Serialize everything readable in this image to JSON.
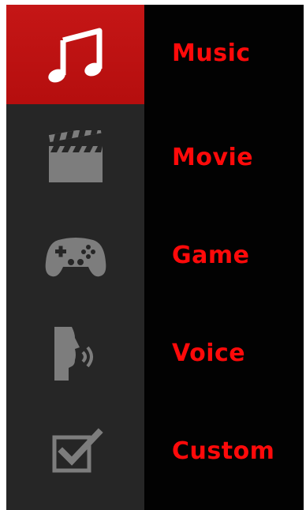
{
  "colors": {
    "background": "#020202",
    "sidebar": "#262626",
    "active": "#c51616",
    "label": "#ff0a0a",
    "icon_inactive": "#7d7d7d",
    "icon_active": "#ffffff"
  },
  "modes": [
    {
      "label": "Music",
      "icon": "music-note-icon",
      "selected": true
    },
    {
      "label": "Movie",
      "icon": "clapperboard-icon",
      "selected": false
    },
    {
      "label": "Game",
      "icon": "gamepad-icon",
      "selected": false
    },
    {
      "label": "Voice",
      "icon": "voice-profile-icon",
      "selected": false
    },
    {
      "label": "Custom",
      "icon": "checkbox-icon",
      "selected": false
    }
  ]
}
